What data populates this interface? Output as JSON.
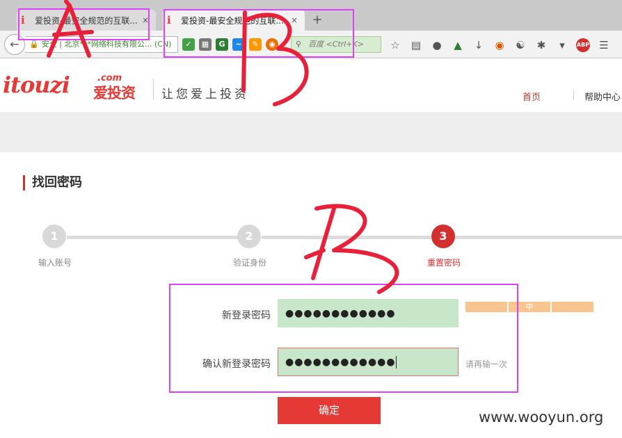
{
  "browser": {
    "tabs": [
      {
        "title": "爱投资-最安全规范的互联...",
        "close": "×",
        "active": false
      },
      {
        "title": "爱投资-最安全规范的互联...",
        "close": "×",
        "active": true
      }
    ],
    "new_tab": "+",
    "url_text": "安全 | 北京***网络科技有限公... (CN)",
    "search_placeholder": "百度 <Ctrl+K>"
  },
  "site": {
    "logo_text": "itouzi",
    "logo_com": ".com",
    "logo_cn": "爱投资",
    "slogan": "让您爱上投资",
    "nav": {
      "home": "首页",
      "help": "帮助中心"
    }
  },
  "page": {
    "title": "找回密码",
    "steps": [
      {
        "number": "1",
        "label": "输入账号",
        "active": false
      },
      {
        "number": "2",
        "label": "验证身份",
        "active": false
      },
      {
        "number": "3",
        "label": "重置密码",
        "active": true
      }
    ],
    "form": {
      "new_password_label": "新登录密码",
      "new_password_value": "●●●●●●●●●●●●",
      "strength_label": "中",
      "confirm_password_label": "确认新登录密码",
      "confirm_password_value": "●●●●●●●●●●●●",
      "confirm_hint": "请再输一次",
      "submit_label": "确定"
    }
  },
  "watermark": "www.wooyun.org",
  "annotation_color": "#e040fb",
  "scribble_color": "#e8203a"
}
